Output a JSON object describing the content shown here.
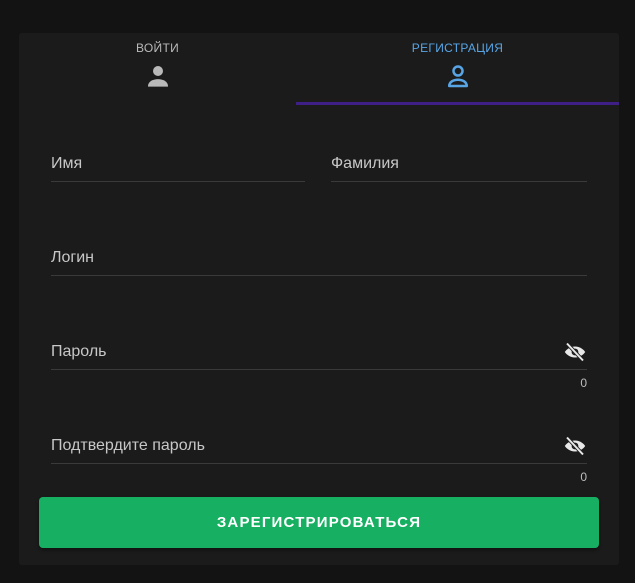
{
  "tabs": {
    "login": {
      "label": "ВОЙТИ",
      "icon": "person-icon"
    },
    "register": {
      "label": "РЕГИСТРАЦИЯ",
      "icon": "person-outline-icon",
      "active": true
    }
  },
  "form": {
    "first_name": {
      "label": "Имя",
      "value": ""
    },
    "last_name": {
      "label": "Фамилия",
      "value": ""
    },
    "login": {
      "label": "Логин",
      "value": ""
    },
    "password": {
      "label": "Пароль",
      "value": "",
      "counter": "0",
      "toggle_icon": "eye-off-icon"
    },
    "confirm_password": {
      "label": "Подтвердите пароль",
      "value": "",
      "counter": "0",
      "toggle_icon": "eye-off-icon"
    }
  },
  "submit": {
    "label": "ЗАРЕГИСТРИРОВАТЬСЯ"
  },
  "colors": {
    "background": "#131313",
    "card": "#1b1b1b",
    "active_tab": "#58a5e6",
    "tab_indicator": "#3e1f86",
    "submit": "#17b062"
  }
}
